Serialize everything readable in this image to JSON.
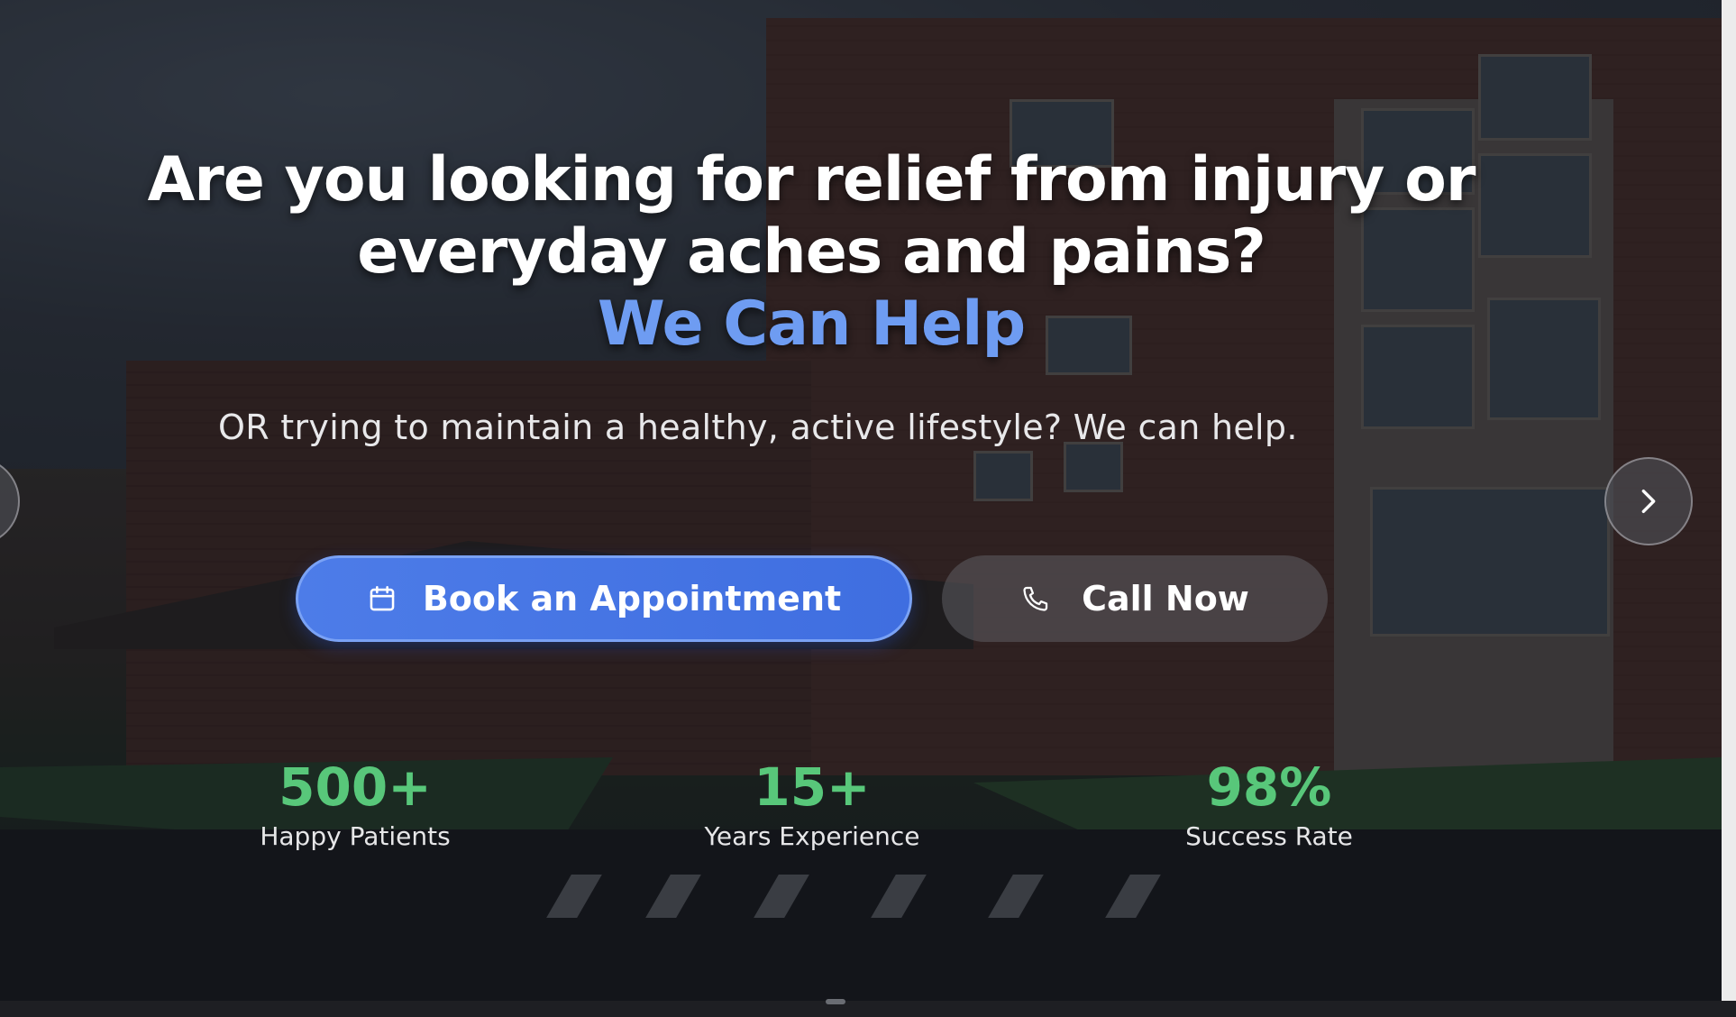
{
  "hero": {
    "headline_line1": "Are you looking for relief from injury or",
    "headline_line2": "everyday aches and pains?",
    "accent": "We Can Help",
    "subtitle": "OR trying to maintain a healthy, active lifestyle? We can help."
  },
  "actions": {
    "book_label": "Book an Appointment",
    "book_icon": "calendar-icon",
    "call_label": "Call Now",
    "call_icon": "phone-icon"
  },
  "carousel": {
    "next_icon": "chevron-right-icon",
    "prev_icon": "chevron-left-icon"
  },
  "stats": [
    {
      "value": "500+",
      "label": "Happy Patients"
    },
    {
      "value": "15+",
      "label": "Years Experience"
    },
    {
      "value": "98%",
      "label": "Success Rate"
    }
  ],
  "colors": {
    "accent_blue": "#6e9cf2",
    "primary_button": "#4d7ce8",
    "stat_green": "#58c77a"
  }
}
